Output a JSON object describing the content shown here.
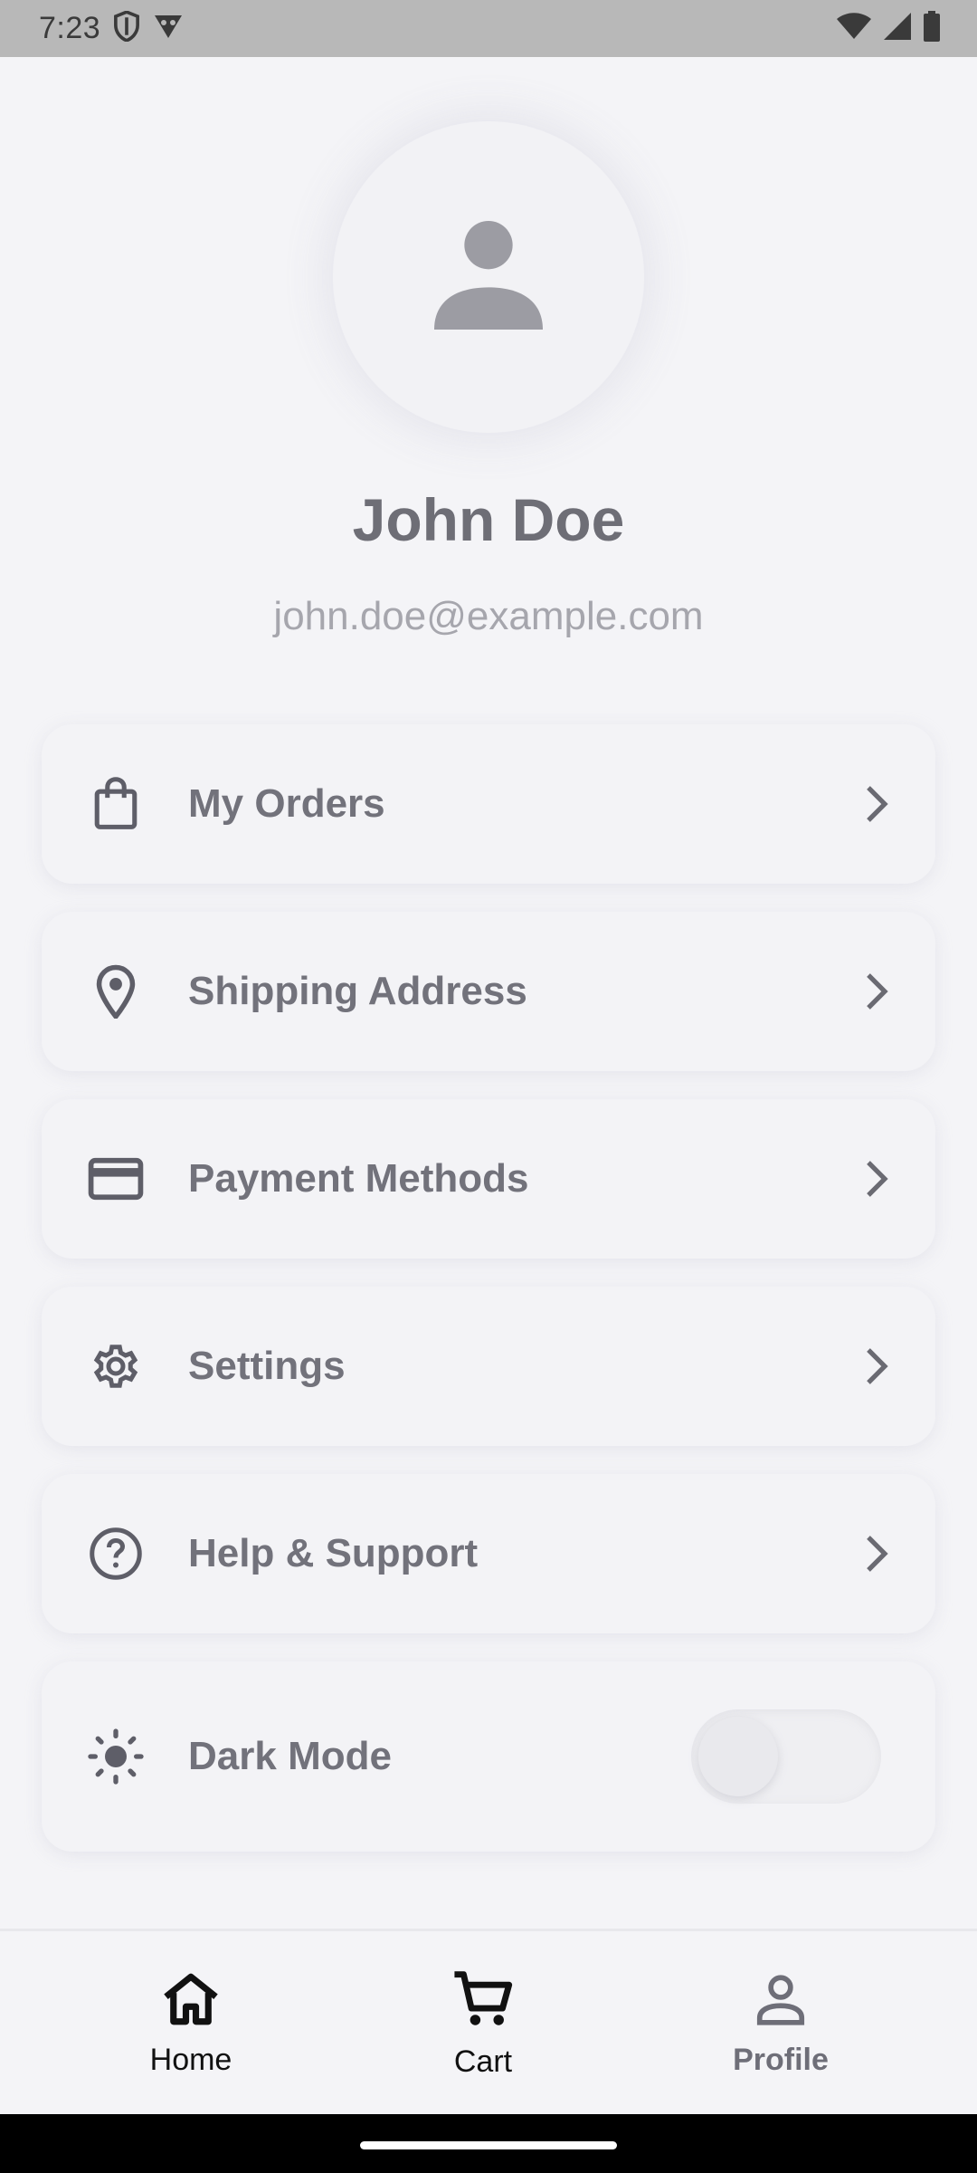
{
  "status_bar": {
    "time": "7:23",
    "left_icons": [
      "shield-icon",
      "vpn-icon"
    ],
    "right_icons": [
      "wifi-icon",
      "signal-icon",
      "battery-icon"
    ]
  },
  "profile": {
    "avatar_icon": "person-icon",
    "name": "John Doe",
    "email": "john.doe@example.com"
  },
  "menu": {
    "items": [
      {
        "label": "My Orders",
        "icon": "shopping-bag-icon"
      },
      {
        "label": "Shipping Address",
        "icon": "location-pin-icon"
      },
      {
        "label": "Payment Methods",
        "icon": "credit-card-icon"
      },
      {
        "label": "Settings",
        "icon": "gear-icon"
      },
      {
        "label": "Help & Support",
        "icon": "help-circle-icon"
      }
    ],
    "dark_mode": {
      "label": "Dark Mode",
      "icon": "sun-icon",
      "enabled": false
    }
  },
  "bottom_nav": {
    "items": [
      {
        "label": "Home",
        "icon": "home-icon"
      },
      {
        "label": "Cart",
        "icon": "cart-icon"
      },
      {
        "label": "Profile",
        "icon": "profile-icon",
        "selected": true
      }
    ]
  },
  "colors": {
    "background": "#f4f4f7",
    "text_primary": "#6e6e76",
    "icon": "#5e5e68",
    "email": "#a6a6ad"
  }
}
